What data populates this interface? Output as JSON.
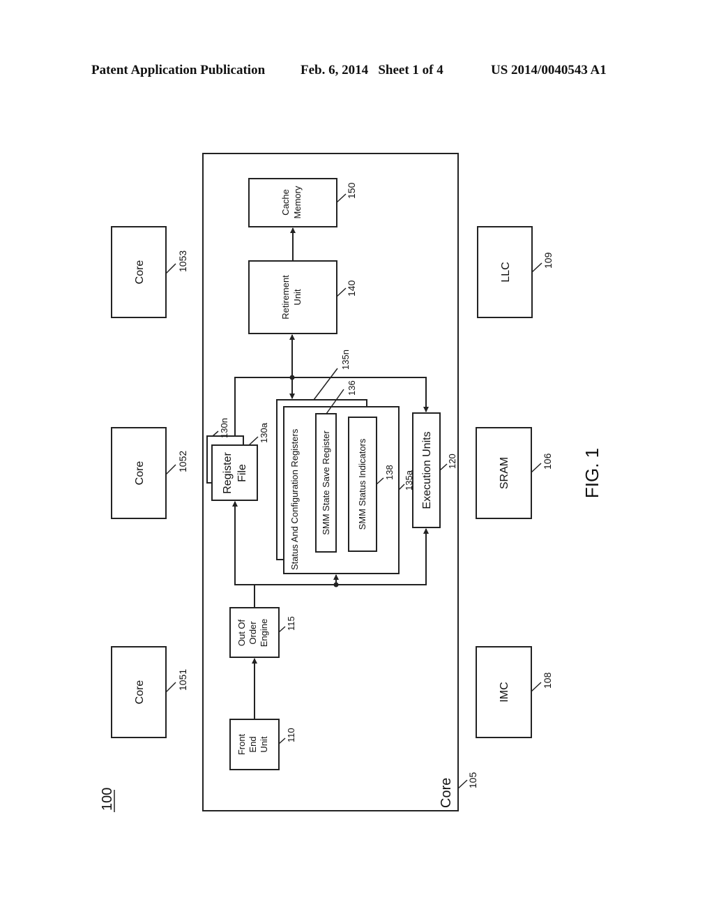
{
  "header": {
    "publication": "Patent Application Publication",
    "date_sheet": "Feb. 6, 2014   Sheet 1 of 4",
    "number": "US 2014/0040543 A1"
  },
  "figure": {
    "label": "FIG. 1",
    "system_ref": "100",
    "core_main": {
      "label": "Core",
      "ref": "105"
    },
    "blocks": {
      "cache_memory": {
        "lines": [
          "Cache",
          "Memory"
        ],
        "ref": "150"
      },
      "retirement_unit": {
        "lines": [
          "Retirement",
          "Unit"
        ],
        "ref": "140"
      },
      "register_file": {
        "lines": [
          "Register",
          "File"
        ],
        "ref_a": "130a",
        "ref_n": "130n"
      },
      "status_config": {
        "label": "Status And Configuration Registers",
        "ref_a": "135a",
        "ref_n": "135n"
      },
      "smm_state_save": {
        "label": "SMM State Save Register",
        "ref": "136"
      },
      "smm_status": {
        "label": "SMM Status Indicators",
        "ref": "138"
      },
      "execution_units": {
        "label": "Execution Units",
        "ref": "120"
      },
      "ooo_engine": {
        "lines": [
          "Out Of",
          "Order",
          "Engine"
        ],
        "ref": "115"
      },
      "front_end": {
        "lines": [
          "Front",
          "End",
          "Unit"
        ],
        "ref": "110"
      }
    },
    "cores": [
      {
        "label": "Core",
        "ref": "105",
        "sub": "3"
      },
      {
        "label": "Core",
        "ref": "105",
        "sub": "2"
      },
      {
        "label": "Core",
        "ref": "105",
        "sub": "1"
      }
    ],
    "uncore": [
      {
        "label": "LLC",
        "ref": "109"
      },
      {
        "label": "SRAM",
        "ref": "106"
      },
      {
        "label": "IMC",
        "ref": "108"
      }
    ]
  }
}
